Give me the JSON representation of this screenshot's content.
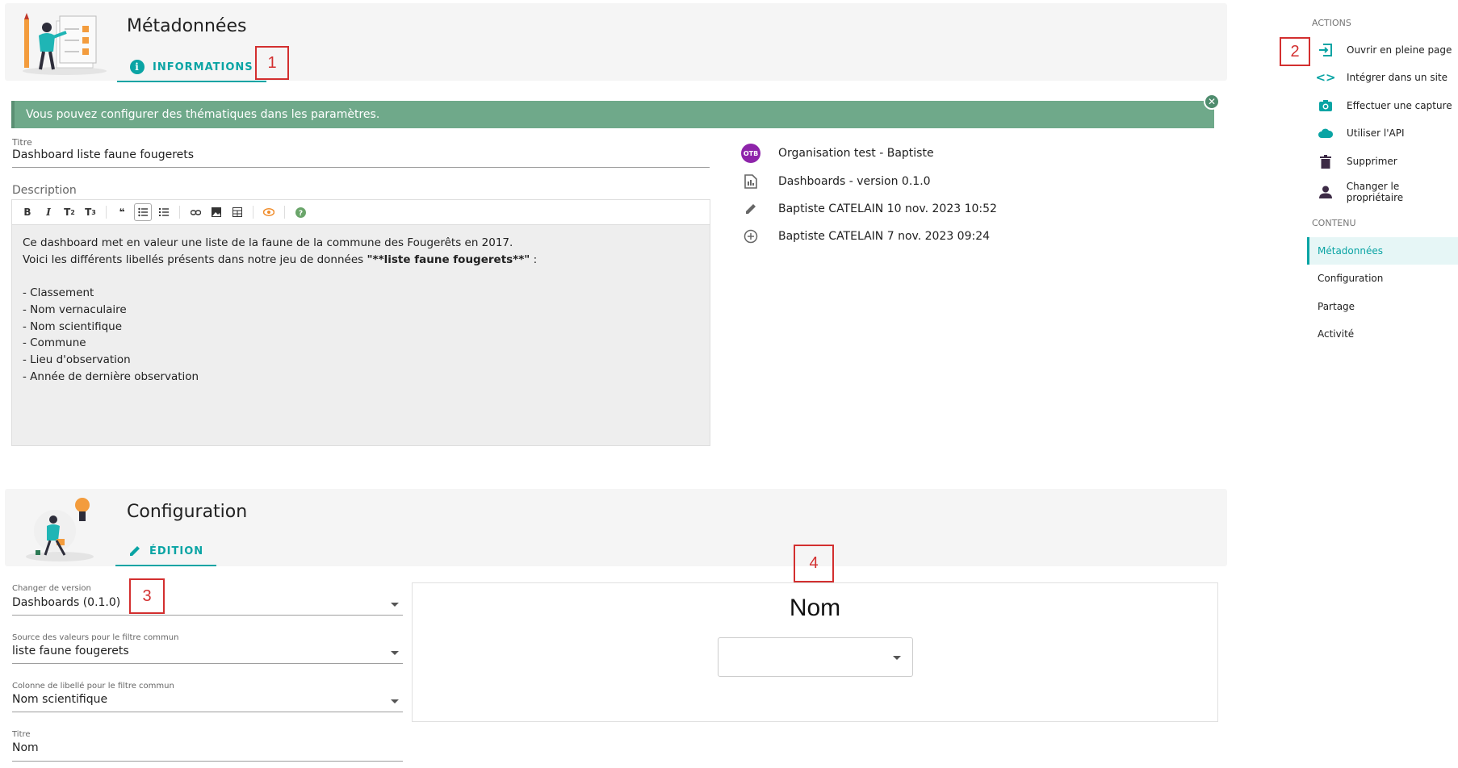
{
  "metadata": {
    "title": "Métadonnées",
    "tab_label": "INFORMATIONS",
    "annotation_1": "1",
    "alert_text": "Vous pouvez configurer des thématiques dans les paramètres.",
    "alert_close": "✕",
    "titre_label": "Titre",
    "titre_value": "Dashboard liste faune fougerets",
    "description_label": "Description",
    "toolbar": [
      "B",
      "I",
      "T2",
      "T3",
      "❝",
      "list",
      "numlist",
      "link",
      "image",
      "table",
      "preview",
      "help"
    ],
    "description_lines": [
      "Ce dashboard met en valeur une liste de la faune de la commune des Fougerêts en 2017.",
      "Voici les différents libellés présents dans notre jeu de données ",
      "",
      "- Classement",
      "- Nom vernaculaire",
      "- Nom scientifique",
      "- Commune",
      "- Lieu d'observation",
      "- Année de dernière observation"
    ],
    "description_bold": "\"**liste faune fougerets**\"",
    "description_tail": " :",
    "info": {
      "org_badge": "OTB",
      "org": "Organisation test - Baptiste",
      "app": "Dashboards - version 0.1.0",
      "updated": "Baptiste CATELAIN 10 nov. 2023 10:52",
      "created": "Baptiste CATELAIN 7 nov. 2023 09:24"
    }
  },
  "sidebar": {
    "actions_heading": "ACTIONS",
    "annotation_2": "2",
    "actions": [
      {
        "label": "Ouvrir en pleine page",
        "icon": "open-fullpage-icon"
      },
      {
        "label": "Intégrer dans un site",
        "icon": "code-icon"
      },
      {
        "label": "Effectuer une capture",
        "icon": "camera-icon"
      },
      {
        "label": "Utiliser l'API",
        "icon": "cloud-icon"
      },
      {
        "label": "Supprimer",
        "icon": "trash-icon"
      },
      {
        "label": "Changer le propriétaire",
        "icon": "person-icon"
      }
    ],
    "content_heading": "CONTENU",
    "nav": [
      "Métadonnées",
      "Configuration",
      "Partage",
      "Activité"
    ]
  },
  "configuration": {
    "title": "Configuration",
    "tab_label": "ÉDITION",
    "annotation_3": "3",
    "annotation_4": "4",
    "version_label": "Changer de version",
    "version_value": "Dashboards (0.1.0)",
    "source_label": "Source des valeurs pour le filtre commun",
    "source_value": "liste faune fougerets",
    "column_label": "Colonne de libellé pour le filtre commun",
    "column_value": "Nom scientifique",
    "titre_label": "Titre",
    "titre_value": "Nom",
    "preview_title": "Nom"
  },
  "colors": {
    "accent": "#0aa4a4",
    "alert": "#6fa98a",
    "annotation": "#d32f2f",
    "org_badge": "#8e24aa"
  }
}
